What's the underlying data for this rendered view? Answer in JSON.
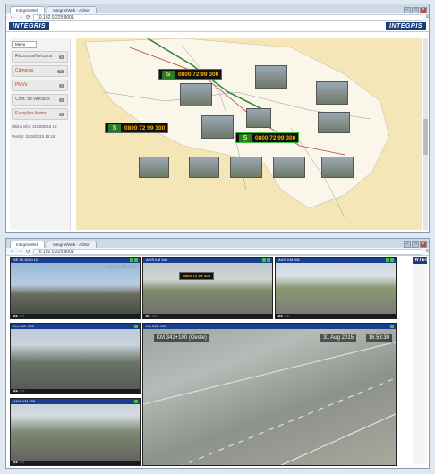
{
  "window1": {
    "tab_label": "Integris/Web",
    "tab2_label": "Integris/Web - Admin",
    "url": "10.192.0.225:9001",
    "brand_left": "INTEGRIS",
    "brand_right": "INTEGRIS",
    "sidebar": {
      "menu_label": "Menu",
      "items": [
        {
          "label": "Recursos/Veículos",
          "count": "0"
        },
        {
          "label": "Câmeras",
          "count": "21"
        },
        {
          "label": "PMVs",
          "count": "2"
        },
        {
          "label": "Cont. de veículos",
          "count": "0"
        },
        {
          "label": "Estações Meteo.",
          "count": "0"
        }
      ],
      "last_info": "Última info.: 31/08/2015 16:",
      "version": "Versão: 31/08/2015 15:18"
    },
    "vms_phone": "0800 72 99 300",
    "vms_logo": "S"
  },
  "window2": {
    "tab_label": "Integris/Web",
    "tab2_label": "Integris/Web - Admin",
    "url": "10.192.0.225:9001",
    "brand_right": "INTEGRIS",
    "cameras": [
      {
        "title": "SE 10.111.0.12",
        "date": "31 Ago 2015 16:53"
      },
      {
        "title": "AXIS KM 340",
        "date": ""
      },
      {
        "title": "AXIS KM 341",
        "date": ""
      },
      {
        "title": "Km 340+100",
        "date": ""
      },
      {
        "title": "AXIS KM 339",
        "date": ""
      },
      {
        "title": "Km 341+100",
        "date": ""
      }
    ],
    "big_overlay": "KM 341+100 (Oeste)",
    "big_date": "31 Aug 2015",
    "big_time": "16:53:30",
    "vms_phone": "0800 72 99 300"
  },
  "colors": {
    "brand": "#1c3f7a",
    "map": "#f5e6b8",
    "vms_text": "#ffb000"
  }
}
